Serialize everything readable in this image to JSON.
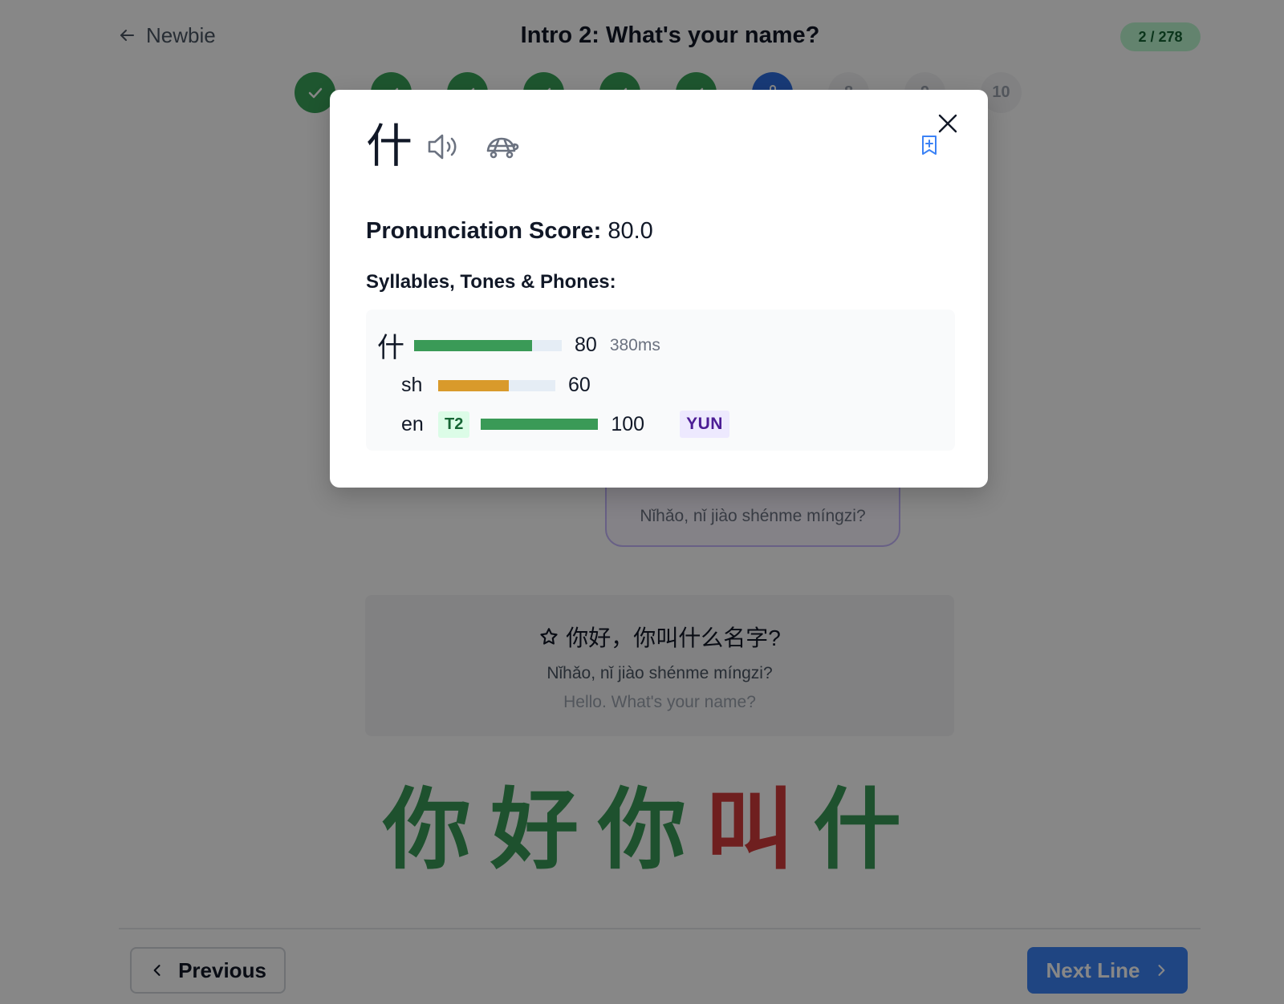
{
  "header": {
    "back_label": "Newbie",
    "title": "Intro 2: What's your name?",
    "counter": "2 / 278"
  },
  "steps": [
    {
      "state": "done"
    },
    {
      "state": "done"
    },
    {
      "state": "done"
    },
    {
      "state": "done"
    },
    {
      "state": "done"
    },
    {
      "state": "done"
    },
    {
      "state": "current"
    },
    {
      "state": "pending",
      "label": "8"
    },
    {
      "state": "pending",
      "label": "9"
    },
    {
      "state": "pending",
      "label": "10"
    }
  ],
  "bubble": {
    "pinyin": "Nǐhǎo, nǐ jiào shénme míngzi?"
  },
  "line_card": {
    "hanzi": "你好，你叫什么名字?",
    "pinyin": "Nǐhǎo, nǐ jiào shénme míngzi?",
    "translation": "Hello. What's your name?"
  },
  "big_chars": [
    {
      "char": "你",
      "color": "#3a9a57"
    },
    {
      "char": "好",
      "color": "#3a9a57"
    },
    {
      "char": "你",
      "color": "#3a9a57"
    },
    {
      "char": "叫",
      "color": "#d23c3c"
    },
    {
      "char": "什",
      "color": "#3a9a57"
    }
  ],
  "nav": {
    "previous_label": "Previous",
    "next_label": "Next Line"
  },
  "modal": {
    "character": "什",
    "score_label": "Pronunciation Score:",
    "score_value": "80.0",
    "section_title": "Syllables, Tones & Phones:",
    "syllable": {
      "char": "什",
      "score": 80,
      "score_text": "80",
      "duration": "380ms",
      "color": "#3a9a57"
    },
    "phones": [
      {
        "label": "sh",
        "score": 60,
        "score_text": "60",
        "color": "#d99a2b"
      },
      {
        "label": "en",
        "tone": "T2",
        "score": 100,
        "score_text": "100",
        "type": "YUN",
        "color": "#3a9a57"
      }
    ]
  },
  "colors": {
    "accent_blue": "#3b82f6",
    "success_green": "#3a9a57",
    "warning_amber": "#d99a2b",
    "error_red": "#d23c3c"
  }
}
